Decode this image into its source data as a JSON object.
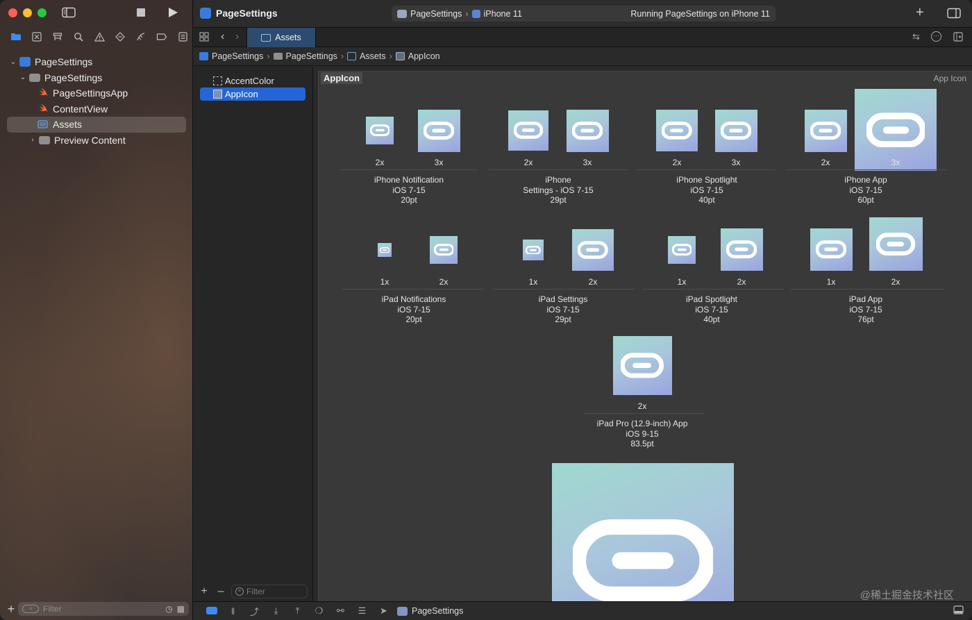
{
  "window": {
    "scheme": "PageSettings",
    "device": "iPhone 11",
    "run_status": "Running PageSettings on iPhone 11",
    "project_title": "PageSettings"
  },
  "tab": {
    "label": "Assets"
  },
  "navigator": {
    "tree": [
      {
        "label": "PageSettings",
        "icon": "xcode-project-icon",
        "expanded": true
      },
      {
        "label": "PageSettings",
        "icon": "folder-icon",
        "expanded": true
      },
      {
        "label": "PageSettingsApp",
        "icon": "swift-file-icon"
      },
      {
        "label": "ContentView",
        "icon": "swift-file-icon"
      },
      {
        "label": "Assets",
        "icon": "asset-catalog-icon",
        "selected": true
      },
      {
        "label": "Preview Content",
        "icon": "folder-icon",
        "expanded": false
      }
    ],
    "filter_placeholder": "Filter"
  },
  "breadcrumb": [
    "PageSettings",
    "PageSettings",
    "Assets",
    "AppIcon"
  ],
  "asset_list": {
    "items": [
      {
        "label": "AccentColor",
        "icon": "color-set-icon"
      },
      {
        "label": "AppIcon",
        "icon": "app-icon-set-icon",
        "selected": true
      }
    ],
    "filter_placeholder": "Filter"
  },
  "editor": {
    "set_name": "AppIcon",
    "set_kind": "App Icon",
    "groups": [
      {
        "line1": "iPhone Notification",
        "line2": "iOS 7-15",
        "line3": "20pt",
        "slots": [
          "2x",
          "3x"
        ]
      },
      {
        "line1": "iPhone",
        "line2": "Settings - iOS 7-15",
        "line3": "29pt",
        "slots": [
          "2x",
          "3x"
        ]
      },
      {
        "line1": "iPhone Spotlight",
        "line2": "iOS 7-15",
        "line3": "40pt",
        "slots": [
          "2x",
          "3x"
        ]
      },
      {
        "line1": "iPhone App",
        "line2": "iOS 7-15",
        "line3": "60pt",
        "slots": [
          "2x",
          "3x"
        ]
      },
      {
        "line1": "iPad Notifications",
        "line2": "iOS 7-15",
        "line3": "20pt",
        "slots": [
          "1x",
          "2x"
        ]
      },
      {
        "line1": "iPad Settings",
        "line2": "iOS 7-15",
        "line3": "29pt",
        "slots": [
          "1x",
          "2x"
        ]
      },
      {
        "line1": "iPad Spotlight",
        "line2": "iOS 7-15",
        "line3": "40pt",
        "slots": [
          "1x",
          "2x"
        ]
      },
      {
        "line1": "iPad App",
        "line2": "iOS 7-15",
        "line3": "76pt",
        "slots": [
          "1x",
          "2x"
        ]
      },
      {
        "line1": "iPad Pro (12.9-inch) App",
        "line2": "iOS 9-15",
        "line3": "83.5pt",
        "slots": [
          "2x"
        ]
      }
    ]
  },
  "bottom_bar": {
    "target": "PageSettings"
  },
  "watermark": "@稀土掘金技术社区"
}
